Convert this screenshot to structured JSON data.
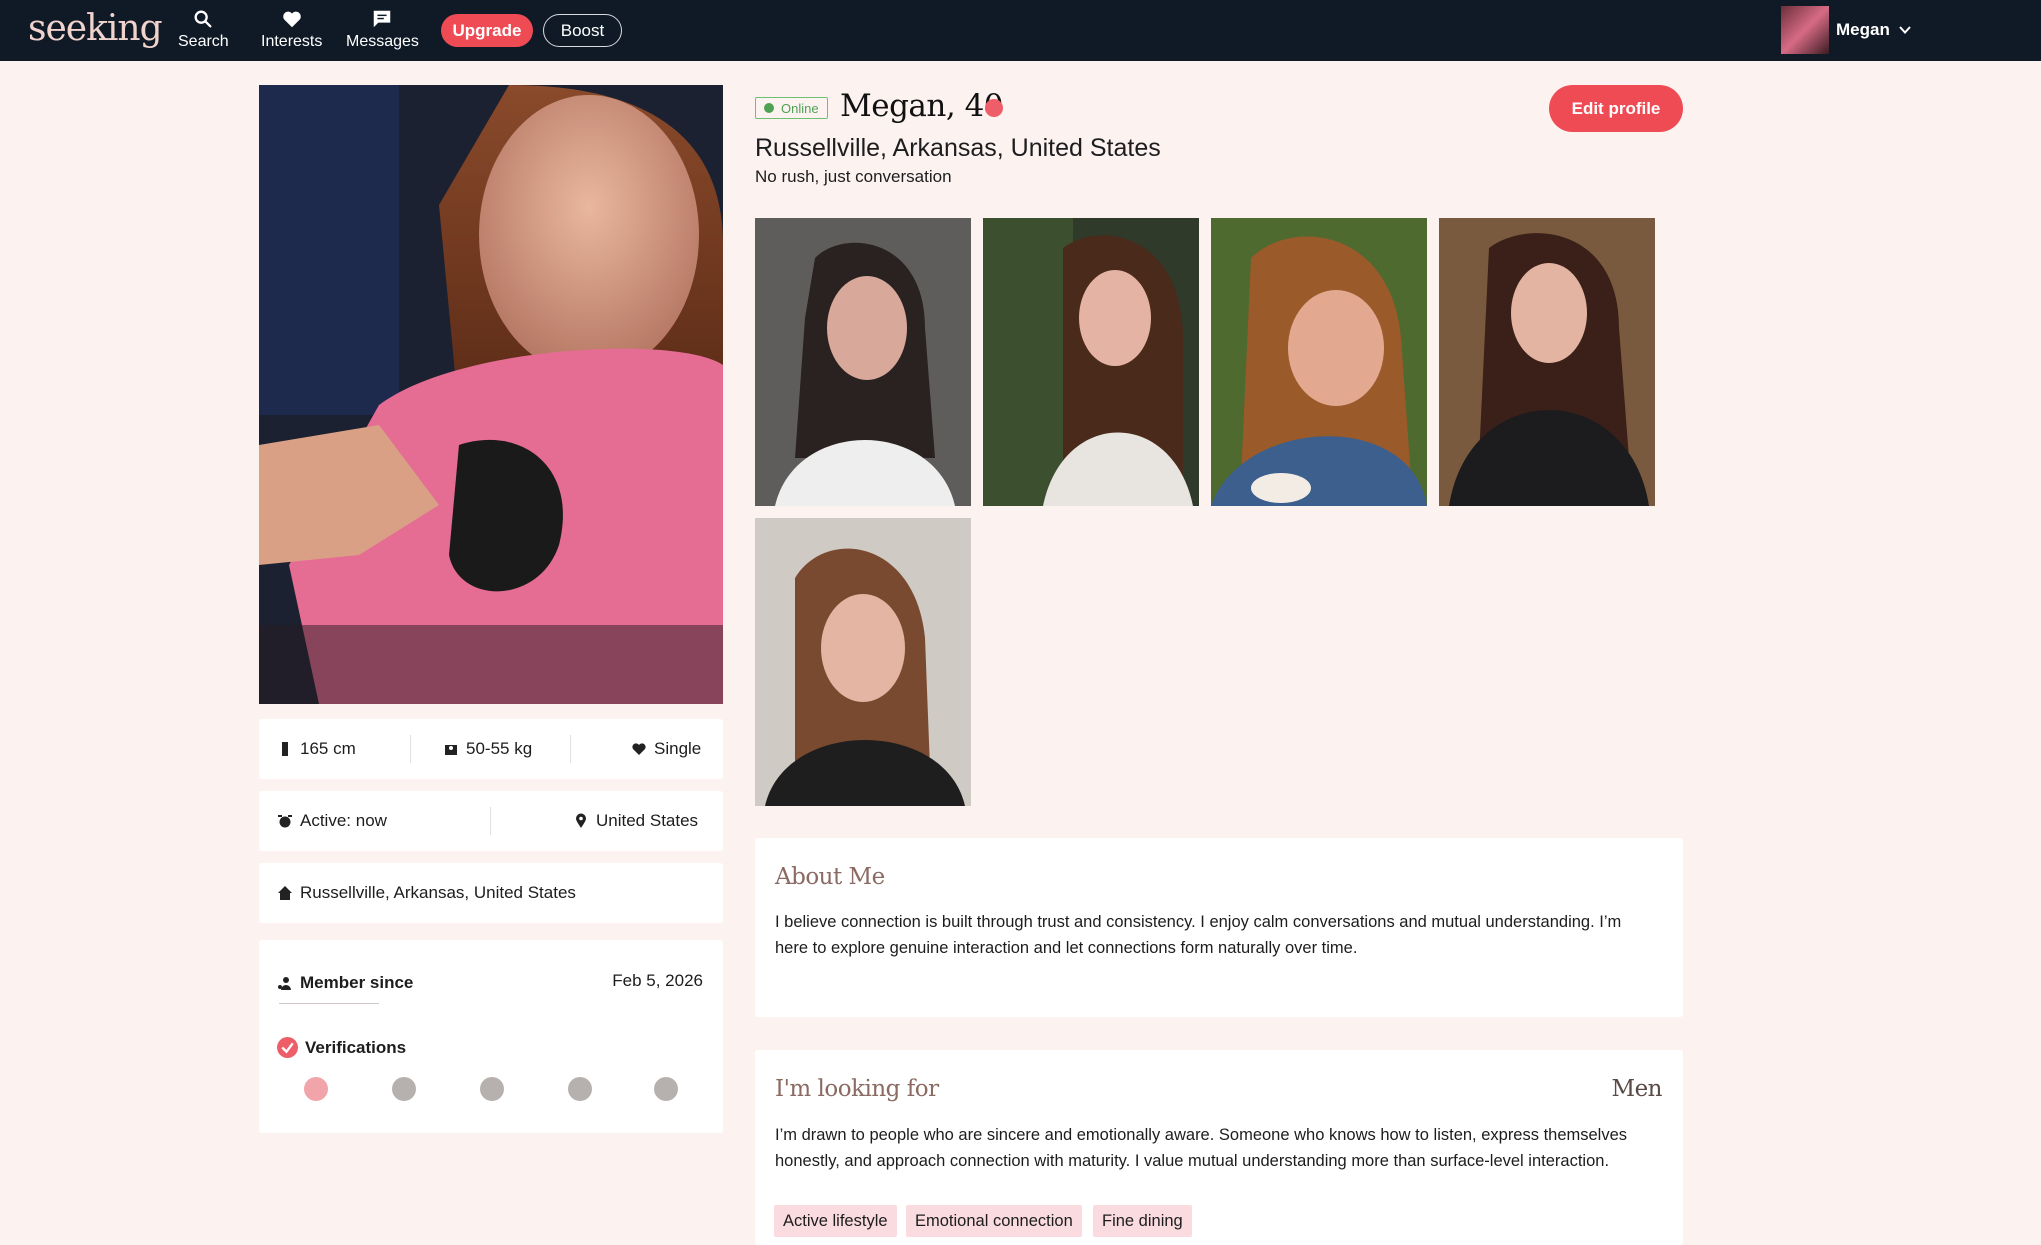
{
  "nav": {
    "logo": "seeking",
    "items": [
      {
        "label": "Search",
        "icon": "search-icon"
      },
      {
        "label": "Interests",
        "icon": "heart-icon"
      },
      {
        "label": "Messages",
        "icon": "chat-icon"
      }
    ],
    "upgrade_label": "Upgrade",
    "boost_label": "Boost",
    "user_name": "Megan"
  },
  "profile": {
    "online_label": "Online",
    "name_age": "Megan, 40",
    "location": "Russellville, Arkansas, United States",
    "tagline": "No rush, just conversation",
    "edit_label": "Edit profile"
  },
  "stats": {
    "height": "165 cm",
    "weight": "50-55 kg",
    "relationship": "Single",
    "active": "Active: now",
    "country": "United States",
    "home": "Russellville, Arkansas, United States",
    "member_since_label": "Member since",
    "member_since_date": "Feb 5, 2026",
    "verifications_label": "Verifications",
    "verification_icons": [
      "photo-verified-icon",
      "profile-icon",
      "id-card-icon",
      "facebook-icon",
      "linkedin-icon"
    ]
  },
  "about": {
    "title": "About Me",
    "text": "I believe connection is built through trust and consistency. I enjoy calm conversations and mutual understanding. I’m here to explore genuine interaction and let connections form naturally over time."
  },
  "looking_for": {
    "title": "I'm looking for",
    "target": "Men",
    "text": "I’m drawn to people who are sincere and emotionally aware. Someone who knows how to listen, express themselves honestly, and approach connection with maturity. I value mutual understanding more than surface-level interaction.",
    "tags": [
      "Active lifestyle",
      "Emotional connection",
      "Fine dining"
    ]
  },
  "colors": {
    "accent": "#ef4b54",
    "nav_bg": "#0f1a26",
    "page_bg": "#fcf3f1",
    "online_green": "#4ea254",
    "section_title": "#8a6a62",
    "tag_bg": "#f9dbe0"
  }
}
